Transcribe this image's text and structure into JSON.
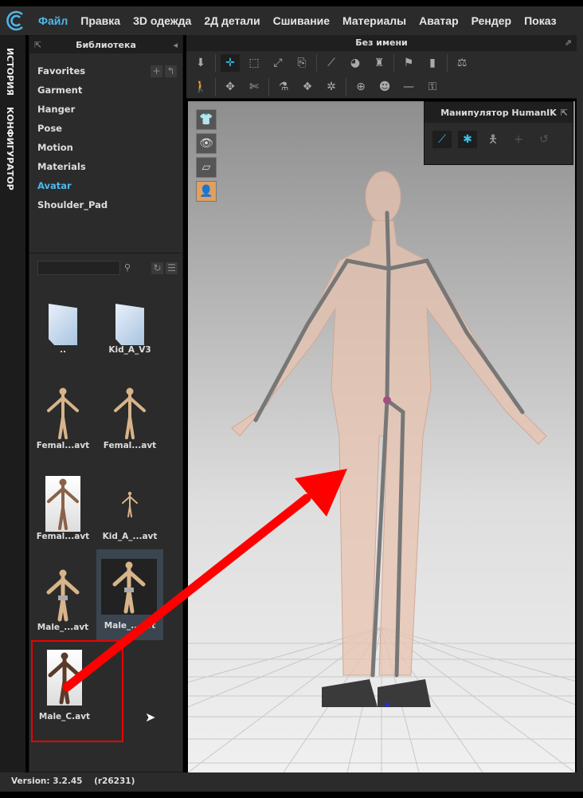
{
  "menu": [
    "Файл",
    "Правка",
    "3D одежда",
    "2Д детали",
    "Сшивание",
    "Материалы",
    "Аватар",
    "Рендер",
    "Показ"
  ],
  "side_tabs": [
    "ИСТОРИЯ",
    "КОНФИГУРАТОР"
  ],
  "library": {
    "title": "Библиотека",
    "categories": [
      "Favorites",
      "Garment",
      "Hanger",
      "Pose",
      "Motion",
      "Materials",
      "Avatar",
      "Shoulder_Pad"
    ],
    "selected": "Avatar",
    "search_placeholder": "",
    "items": [
      "..",
      "Kid_A_V3",
      "Femal...avt",
      "Femal...avt",
      "Femal...avt",
      "Kid_A_...avt",
      "Male_...avt",
      "Male_...avt",
      "Male_C.avt"
    ]
  },
  "viewport": {
    "title": "Без имени"
  },
  "ik_panel": {
    "title": "Манипулятор HumanIK"
  },
  "status": {
    "version": "Version: 3.2.45",
    "revision": "(r26231)"
  },
  "colors": {
    "accent": "#4fb8ea",
    "annotation": "#ff0000"
  }
}
